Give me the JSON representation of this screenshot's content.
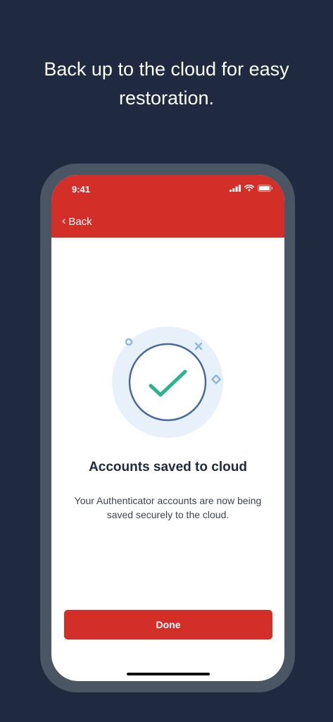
{
  "headline": "Back up to the cloud for easy restoration.",
  "status_bar": {
    "time": "9:41"
  },
  "nav": {
    "back_label": "Back",
    "back_chevron": "‹"
  },
  "main": {
    "title": "Accounts saved to cloud",
    "description": "Your Authenticator accounts are now being saved securely to the cloud."
  },
  "actions": {
    "done_label": "Done"
  },
  "colors": {
    "background": "#1f2a40",
    "accent": "#d42e29",
    "check": "#2bb58a",
    "circle_outline": "#4a6a9c",
    "halo": "#e8f0fa"
  },
  "icons": [
    "signal-icon",
    "wifi-icon",
    "battery-icon",
    "chevron-left-icon",
    "checkmark-icon"
  ]
}
